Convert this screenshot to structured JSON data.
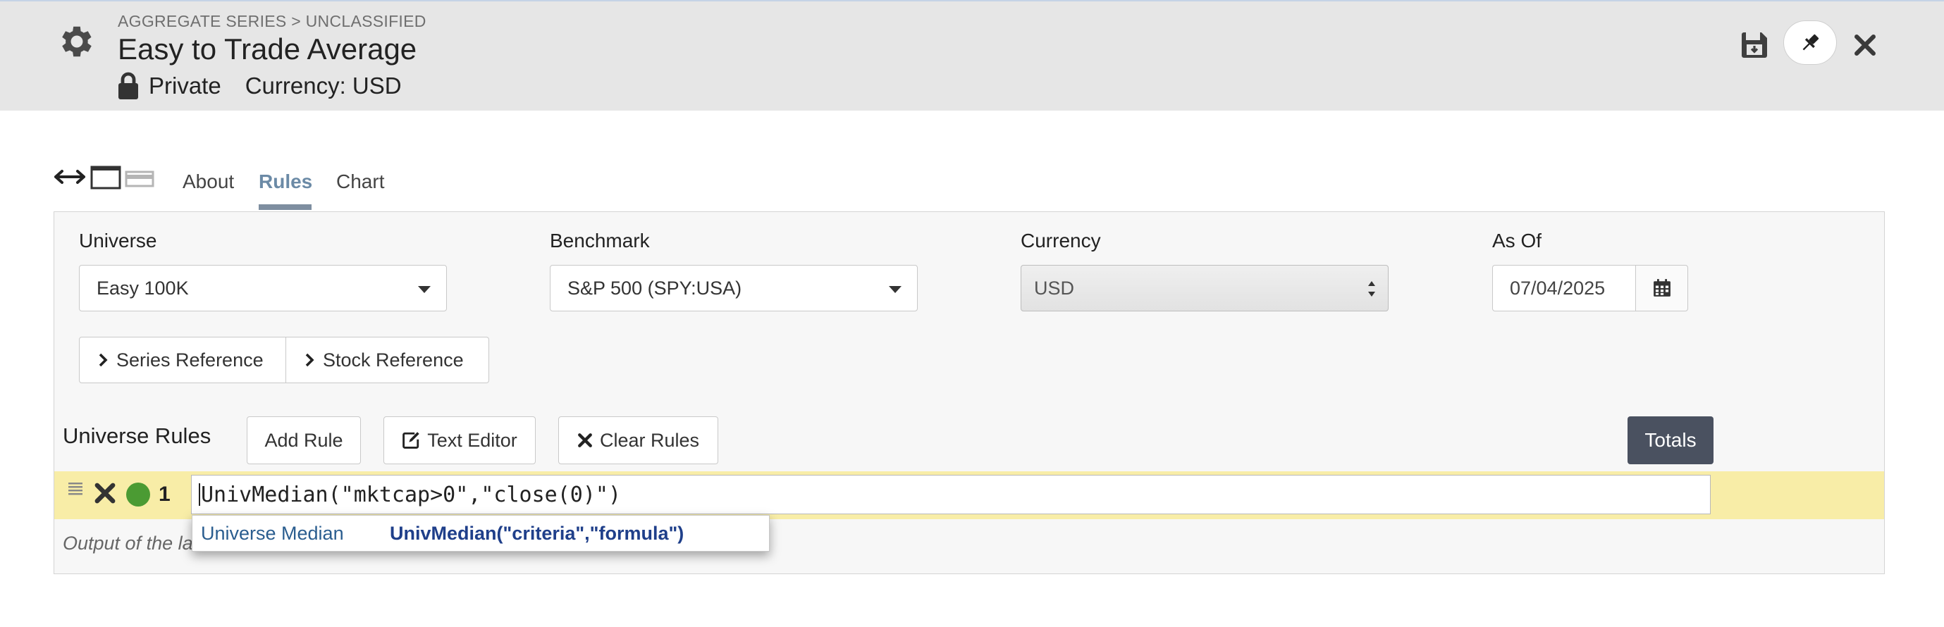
{
  "header": {
    "breadcrumb": "AGGREGATE SERIES > UNCLASSIFIED",
    "title": "Easy to Trade Average",
    "privacy": "Private",
    "currency": "Currency: USD"
  },
  "tabs": [
    {
      "label": "About"
    },
    {
      "label": "Rules",
      "active": true
    },
    {
      "label": "Chart"
    }
  ],
  "form": {
    "universe_label": "Universe",
    "universe_value": "Easy 100K",
    "benchmark_label": "Benchmark",
    "benchmark_value": "S&P 500 (SPY:USA)",
    "currency_label": "Currency",
    "currency_value": "USD",
    "asof_label": "As Of",
    "asof_value": "07/04/2025"
  },
  "reference_buttons": {
    "series": "Series Reference",
    "stock": "Stock Reference"
  },
  "universe_rules": {
    "title": "Universe Rules",
    "add_rule": "Add Rule",
    "text_editor": "Text Editor",
    "clear_rules": "Clear Rules",
    "totals": "Totals",
    "rule_number": "1",
    "rule_text": "UnivMedian(\"mktcap>0\",\"close(0)\")",
    "output_note": "Output of the la"
  },
  "autocomplete": {
    "name": "Universe Median",
    "signature": "UnivMedian(\"criteria\",\"formula\")"
  },
  "colors": {
    "header_bg": "#e6e6e6",
    "active_tab": "#6b8aa6",
    "rule_row_bg": "#f8eda7",
    "status_green": "#4b9b33",
    "totals_bg": "#4a5160"
  }
}
